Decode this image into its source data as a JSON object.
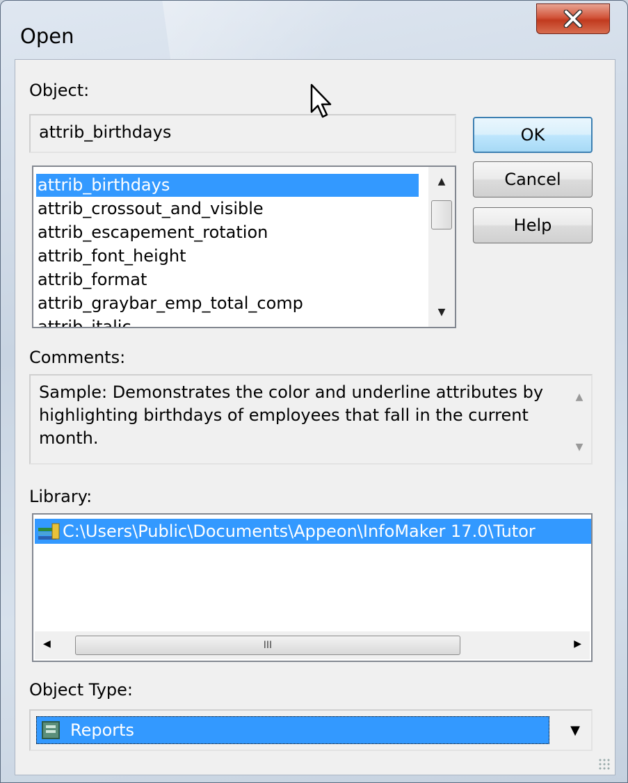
{
  "window": {
    "title": "Open"
  },
  "object": {
    "label": "Object:",
    "value": "attrib_birthdays"
  },
  "objects_list": {
    "items": [
      "attrib_birthdays",
      "attrib_crossout_and_visible",
      "attrib_escapement_rotation",
      "attrib_font_height",
      "attrib_format",
      "attrib_graybar_emp_total_comp",
      "attrib_italic"
    ],
    "selected": "attrib_birthdays"
  },
  "buttons": {
    "ok": "OK",
    "cancel": "Cancel",
    "help": "Help"
  },
  "comments": {
    "label": "Comments:",
    "text": "Sample: Demonstrates the color and underline attributes by highlighting birthdays of employees that fall in the current month."
  },
  "library": {
    "label": "Library:",
    "path": "C:\\Users\\Public\\Documents\\Appeon\\InfoMaker 17.0\\Tutor",
    "hscroll_grip": "III"
  },
  "object_type": {
    "label": "Object Type:",
    "value": "Reports"
  },
  "colors": {
    "selection": "#3399ff",
    "close": "#c13a1f",
    "default_button": "#3c7fb1"
  },
  "icons": [
    "close-icon",
    "library-icon",
    "report-icon",
    "dropdown-arrow-icon"
  ]
}
